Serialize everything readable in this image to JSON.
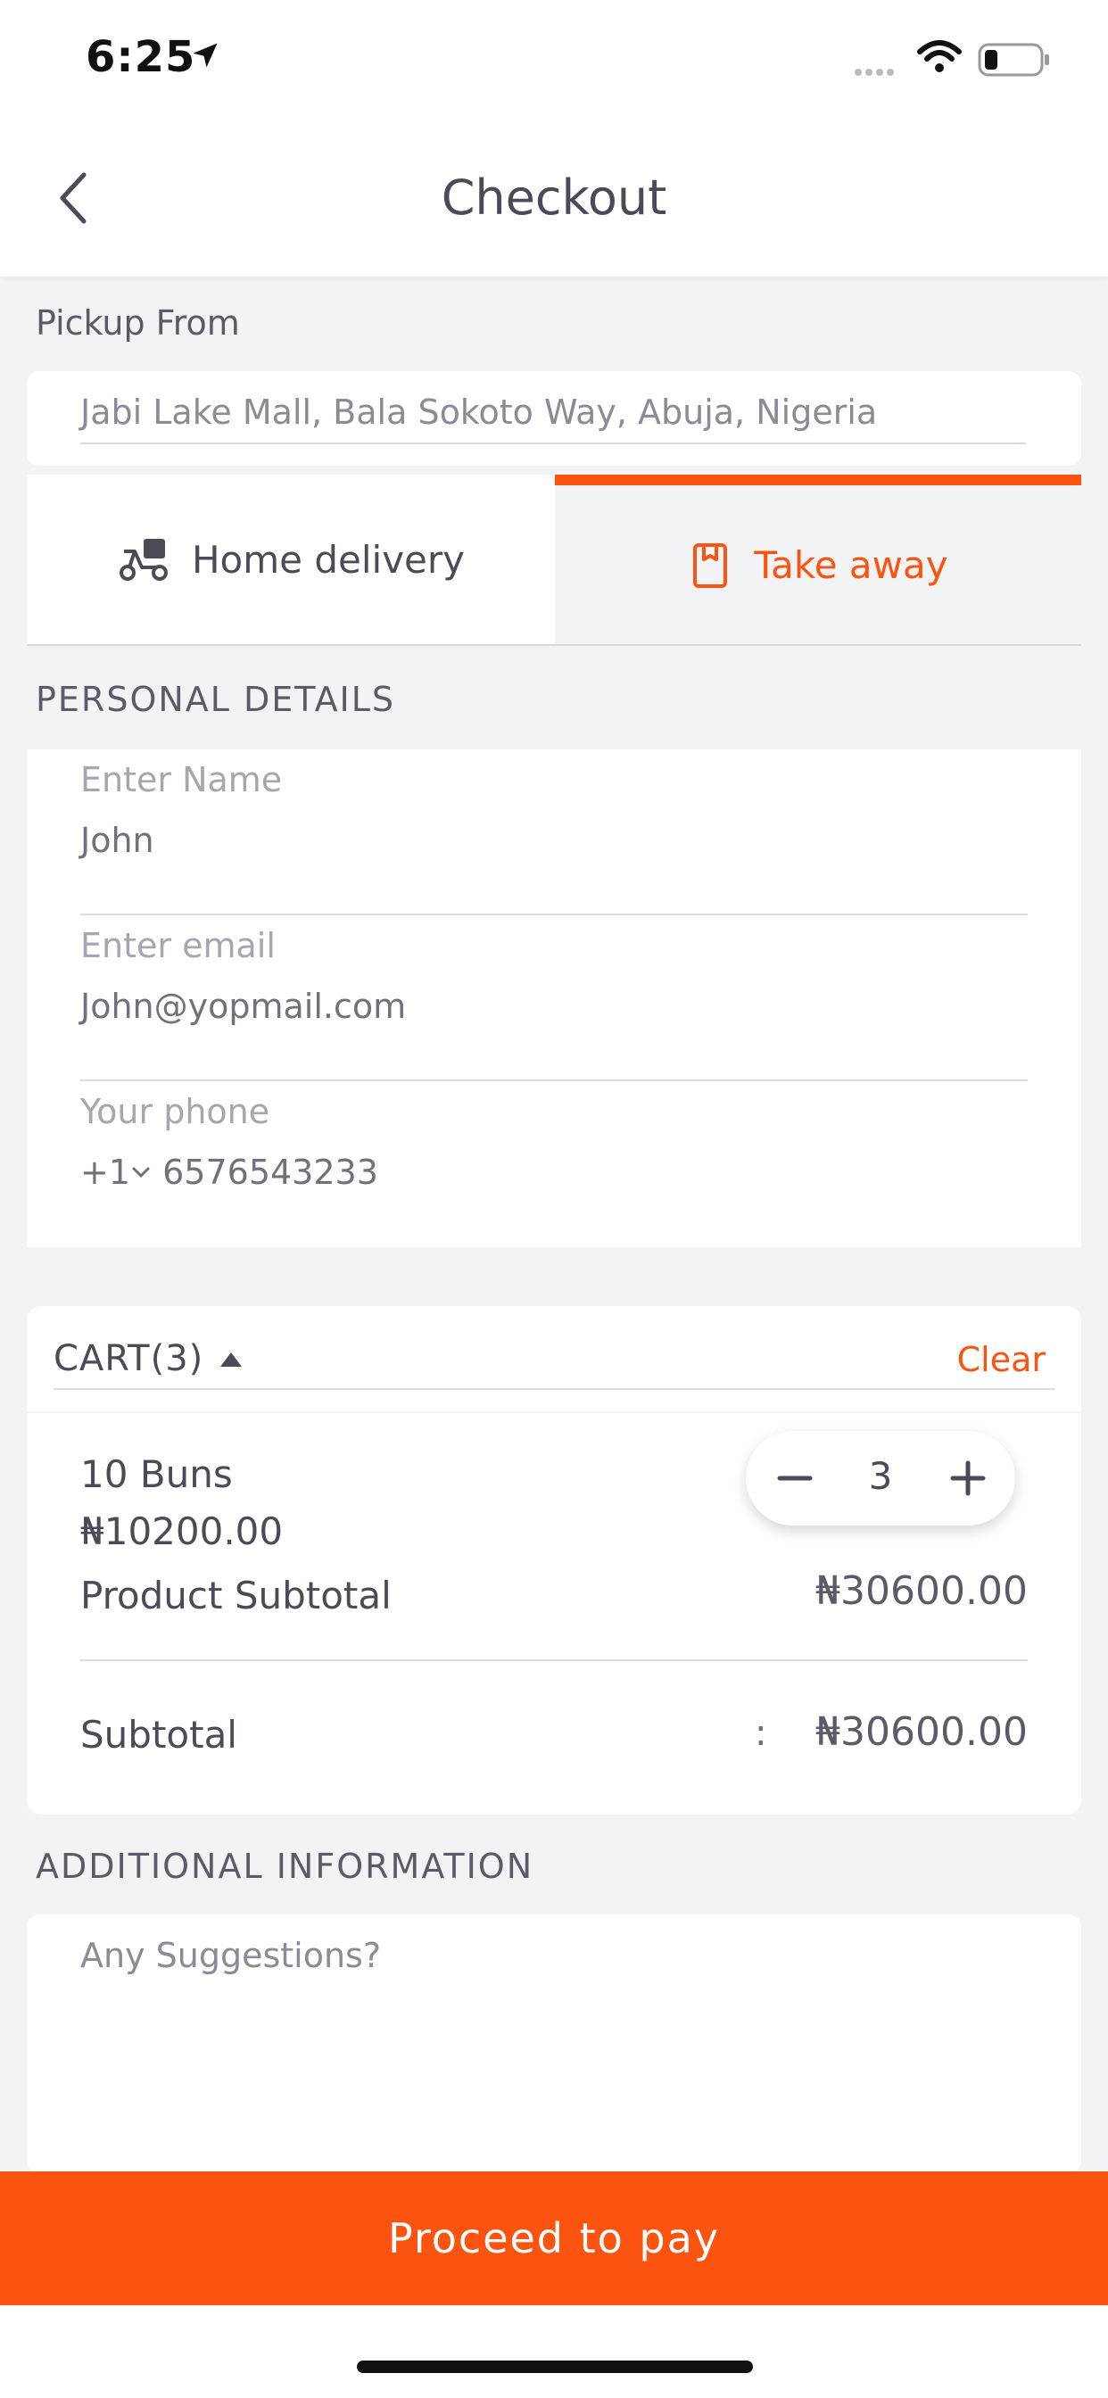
{
  "status_bar": {
    "time": "6:25"
  },
  "header": {
    "title": "Checkout"
  },
  "pickup": {
    "label": "Pickup From",
    "address": "Jabi Lake Mall, Bala Sokoto Way, Abuja, Nigeria"
  },
  "delivery_tabs": [
    {
      "label": "Home delivery",
      "icon": "scooter-icon",
      "selected": false
    },
    {
      "label": "Take away",
      "icon": "bag-icon",
      "selected": true
    }
  ],
  "personal_details": {
    "label": "PERSONAL DETAILS",
    "name": {
      "placeholder": "Enter Name",
      "value": "John"
    },
    "email": {
      "placeholder": "Enter email",
      "value": "John@yopmail.com"
    },
    "phone": {
      "placeholder": "Your phone",
      "country_code": "+1",
      "value": "6576543233"
    }
  },
  "cart": {
    "title": "CART(3)",
    "clear_label": "Clear",
    "items": [
      {
        "name": "10 Buns",
        "price": "₦10200.00",
        "subtotal_label": "Product Subtotal",
        "subtotal_value": "₦30600.00",
        "quantity": "3"
      }
    ],
    "subtotal_label": "Subtotal",
    "subtotal_colon": ":",
    "subtotal_value": "₦30600.00"
  },
  "additional": {
    "label": "ADDITIONAL INFORMATION",
    "placeholder": "Any Suggestions?"
  },
  "pay_button": {
    "label": "Proceed to pay"
  },
  "colors": {
    "accent": "#fc5310",
    "background": "#f2f3f5",
    "text": "#4a4b57"
  }
}
